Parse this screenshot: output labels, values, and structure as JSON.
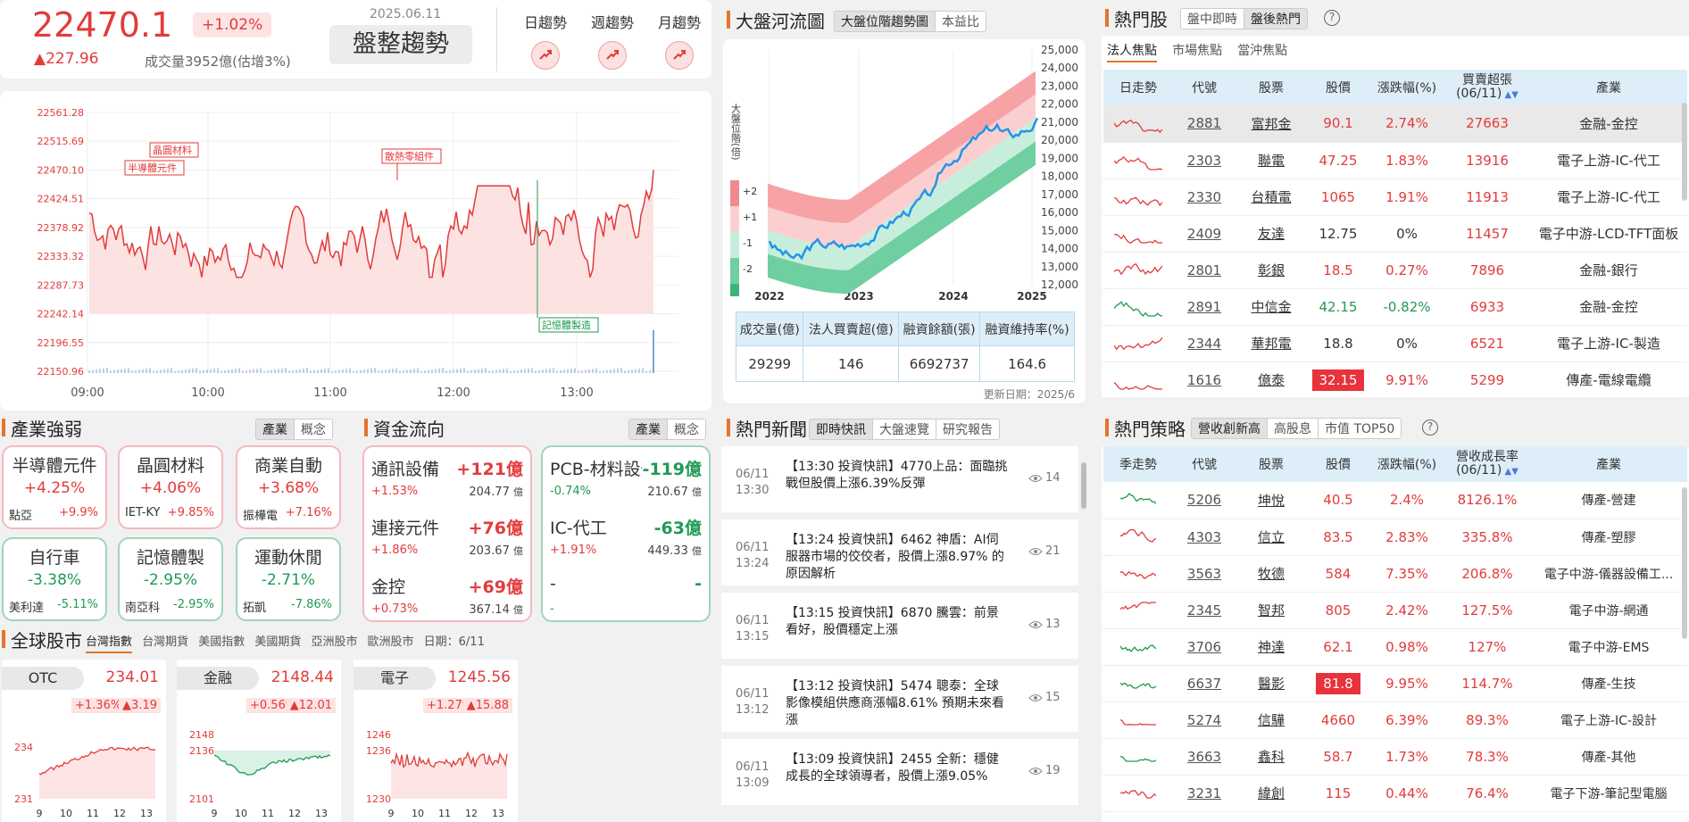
{
  "index": {
    "value": "22470.1",
    "change": "▲227.96",
    "pct": "+1.02%",
    "date": "2025.06.11",
    "trend_label": "盤整趨勢",
    "volume": "成交量3952億(估增3%)",
    "trend_tabs": [
      "日趨勢",
      "週趨勢",
      "月趨勢"
    ]
  },
  "intraday": {
    "yticks": [
      "22561.28",
      "22515.69",
      "22470.10",
      "22424.51",
      "22378.92",
      "22333.32",
      "22287.73",
      "22242.14",
      "22196.55",
      "22150.96"
    ],
    "xticks": [
      "09:00",
      "10:00",
      "11:00",
      "12:00",
      "13:00"
    ],
    "annotations": [
      "晶圓材料",
      "半導體元件",
      "散熱零組件",
      "記憶體製造"
    ]
  },
  "river": {
    "title": "大盤河流圖",
    "tabs": [
      "大盤位階趨勢圖",
      "本益比"
    ],
    "ylabel": "大盤位階(倍)",
    "legend": [
      "+2",
      "+1",
      "-1",
      "-2"
    ],
    "yticks": [
      "25,000",
      "24,000",
      "23,000",
      "22,000",
      "21,000",
      "20,000",
      "19,000",
      "18,000",
      "17,000",
      "16,000",
      "15,000",
      "14,000",
      "13,000",
      "12,000"
    ],
    "xticks": [
      "2022",
      "2023",
      "2024",
      "2025"
    ],
    "stats_headers": [
      "成交量(億)",
      "法人買賣超(億)",
      "融資餘額(張)",
      "融資維持率(%)"
    ],
    "stats_values": [
      "29299",
      "146",
      "6692737",
      "164.6"
    ],
    "update": "更新日期：2025/6"
  },
  "hot_stocks": {
    "title": "熱門股",
    "seg": [
      "盤中即時",
      "盤後熱門"
    ],
    "tabs": [
      "法人焦點",
      "市場焦點",
      "當沖焦點"
    ],
    "headers": [
      "日走勢",
      "代號",
      "股票",
      "股價",
      "漲跌幅(%)",
      "買賣超張\n(06/11)",
      "產業"
    ],
    "rows": [
      {
        "code": "2881",
        "name": "富邦金",
        "price": "90.1",
        "chg": "2.74%",
        "vol": "27663",
        "ind": "金融-金控",
        "dir": "up"
      },
      {
        "code": "2303",
        "name": "聯電",
        "price": "47.25",
        "chg": "1.83%",
        "vol": "13916",
        "ind": "電子上游-IC-代工",
        "dir": "up"
      },
      {
        "code": "2330",
        "name": "台積電",
        "price": "1065",
        "chg": "1.91%",
        "vol": "11913",
        "ind": "電子上游-IC-代工",
        "dir": "up"
      },
      {
        "code": "2409",
        "name": "友達",
        "price": "12.75",
        "chg": "0%",
        "vol": "11457",
        "ind": "電子中游-LCD-TFT面板",
        "dir": "flat"
      },
      {
        "code": "2801",
        "name": "彰銀",
        "price": "18.5",
        "chg": "0.27%",
        "vol": "7896",
        "ind": "金融-銀行",
        "dir": "up"
      },
      {
        "code": "2891",
        "name": "中信金",
        "price": "42.15",
        "chg": "-0.82%",
        "vol": "6933",
        "ind": "金融-金控",
        "dir": "down"
      },
      {
        "code": "2344",
        "name": "華邦電",
        "price": "18.8",
        "chg": "0%",
        "vol": "6521",
        "ind": "電子上游-IC-製造",
        "dir": "flat"
      },
      {
        "code": "1616",
        "name": "億泰",
        "price": "32.15",
        "chg": "9.91%",
        "vol": "5299",
        "ind": "傳產-電線電纜",
        "dir": "limit"
      }
    ]
  },
  "industry": {
    "title": "產業強弱",
    "seg": [
      "產業",
      "概念"
    ],
    "boxes": [
      {
        "name": "半導體元件",
        "pct": "+4.25%",
        "stock": "點亞",
        "spct": "+9.9%",
        "c": "r"
      },
      {
        "name": "晶圓材料",
        "pct": "+4.06%",
        "stock": "IET-KY",
        "spct": "+9.85%",
        "c": "r"
      },
      {
        "name": "商業自動",
        "pct": "+3.68%",
        "stock": "振樺電",
        "spct": "+7.16%",
        "c": "r"
      },
      {
        "name": "自行車",
        "pct": "-3.38%",
        "stock": "美利達",
        "spct": "-5.11%",
        "c": "g"
      },
      {
        "name": "記憶體製",
        "pct": "-2.95%",
        "stock": "南亞科",
        "spct": "-2.95%",
        "c": "g"
      },
      {
        "name": "運動休閒",
        "pct": "-2.71%",
        "stock": "拓凱",
        "spct": "-7.86%",
        "c": "g"
      }
    ]
  },
  "flow": {
    "title": "資金流向",
    "seg": [
      "產業",
      "概念"
    ],
    "in": [
      {
        "name": "通訊設備",
        "amt": "+121億",
        "pct": "+1.53%",
        "vol": "204.77",
        "unit": "億"
      },
      {
        "name": "連接元件",
        "amt": "+76億",
        "pct": "+1.86%",
        "vol": "203.67",
        "unit": "億"
      },
      {
        "name": "金控",
        "amt": "+69億",
        "pct": "+0.73%",
        "vol": "367.14",
        "unit": "億"
      }
    ],
    "out": [
      {
        "name": "PCB-材料設備",
        "amt": "-119億",
        "pct": "-0.74%",
        "vol": "210.67",
        "unit": "億"
      },
      {
        "name": "IC-代工",
        "amt": "-63億",
        "pct": "+1.91%",
        "vol": "449.33",
        "unit": "億"
      },
      {
        "name": "-",
        "amt": "-",
        "pct": "-",
        "vol": "",
        "unit": ""
      }
    ]
  },
  "news": {
    "title": "熱門新聞",
    "seg": [
      "即時快訊",
      "大盤速覽",
      "研究報告"
    ],
    "items": [
      {
        "d": "06/11",
        "t": "13:30",
        "text": "【13:30 投資快訊】4770上品：面臨挑戰但股價上漲6.39%反彈",
        "n": "14"
      },
      {
        "d": "06/11",
        "t": "13:24",
        "text": "【13:24 投資快訊】6462 神盾：AI伺服器市場的佼佼者，股價上漲8.97% 的原因解析",
        "n": "21"
      },
      {
        "d": "06/11",
        "t": "13:15",
        "text": "【13:15 投資快訊】6870 騰雲：前景看好，股價穩定上漲",
        "n": "13"
      },
      {
        "d": "06/11",
        "t": "13:12",
        "text": "【13:12 投資快訊】5474 聰泰：全球影像模組供應商漲幅8.61% 預期未來看漲",
        "n": "15"
      },
      {
        "d": "06/11",
        "t": "13:09",
        "text": "【13:09 投資快訊】2455 全新：穩健成長的全球領導者，股價上漲9.05%",
        "n": "19"
      }
    ]
  },
  "global": {
    "title": "全球股市",
    "tabs": [
      "台灣指數",
      "台灣期貨",
      "美國指數",
      "美國期貨",
      "亞洲股市",
      "歐洲股市"
    ],
    "date": "日期：6/11",
    "cards": [
      {
        "name": "OTC",
        "value": "234.01",
        "pct": "+1.36%",
        "chg": "▲3.19",
        "yt": [
          "234",
          "231"
        ],
        "xt": [
          "9",
          "10",
          "11",
          "12",
          "13"
        ]
      },
      {
        "name": "金融",
        "value": "2148.44",
        "pct": "+0.56%",
        "chg": "▲12.01",
        "yt": [
          "2148",
          "2136",
          "2101"
        ],
        "xt": [
          "9",
          "10",
          "11",
          "12",
          "13"
        ]
      },
      {
        "name": "電子",
        "value": "1245.56",
        "pct": "+1.27%",
        "chg": "▲15.88",
        "yt": [
          "1246",
          "1236",
          "1230"
        ],
        "xt": [
          "9",
          "10",
          "11",
          "12",
          "13"
        ]
      }
    ]
  },
  "strategy": {
    "title": "熱門策略",
    "seg": [
      "營收創新高",
      "高股息",
      "市值 TOP50"
    ],
    "headers": [
      "季走勢",
      "代號",
      "股票",
      "股價",
      "漲跌幅(%)",
      "營收成長率\n(06/11)",
      "產業"
    ],
    "rows": [
      {
        "code": "5206",
        "name": "坤悅",
        "price": "40.5",
        "chg": "2.4%",
        "g": "8126.1%",
        "ind": "傳產-營建",
        "lim": false,
        "c": "g"
      },
      {
        "code": "4303",
        "name": "信立",
        "price": "83.5",
        "chg": "2.83%",
        "g": "335.8%",
        "ind": "傳產-塑膠",
        "lim": false,
        "c": "r"
      },
      {
        "code": "3563",
        "name": "牧德",
        "price": "584",
        "chg": "7.35%",
        "g": "206.8%",
        "ind": "電子中游-儀器設備工...",
        "lim": false,
        "c": "r"
      },
      {
        "code": "2345",
        "name": "智邦",
        "price": "805",
        "chg": "2.42%",
        "g": "127.5%",
        "ind": "電子中游-網通",
        "lim": false,
        "c": "r"
      },
      {
        "code": "3706",
        "name": "神達",
        "price": "62.1",
        "chg": "0.98%",
        "g": "127%",
        "ind": "電子中游-EMS",
        "lim": false,
        "c": "g"
      },
      {
        "code": "6637",
        "name": "醫影",
        "price": "81.8",
        "chg": "9.95%",
        "g": "114.7%",
        "ind": "傳產-生技",
        "lim": true,
        "c": "g"
      },
      {
        "code": "5274",
        "name": "信驊",
        "price": "4660",
        "chg": "6.39%",
        "g": "89.3%",
        "ind": "電子上游-IC-設計",
        "lim": false,
        "c": "r"
      },
      {
        "code": "3663",
        "name": "鑫科",
        "price": "58.7",
        "chg": "1.73%",
        "g": "78.3%",
        "ind": "傳產-其他",
        "lim": false,
        "c": "g"
      },
      {
        "code": "3231",
        "name": "緯創",
        "price": "115",
        "chg": "0.44%",
        "g": "76.4%",
        "ind": "電子下游-筆記型電腦",
        "lim": false,
        "c": "r"
      }
    ]
  }
}
